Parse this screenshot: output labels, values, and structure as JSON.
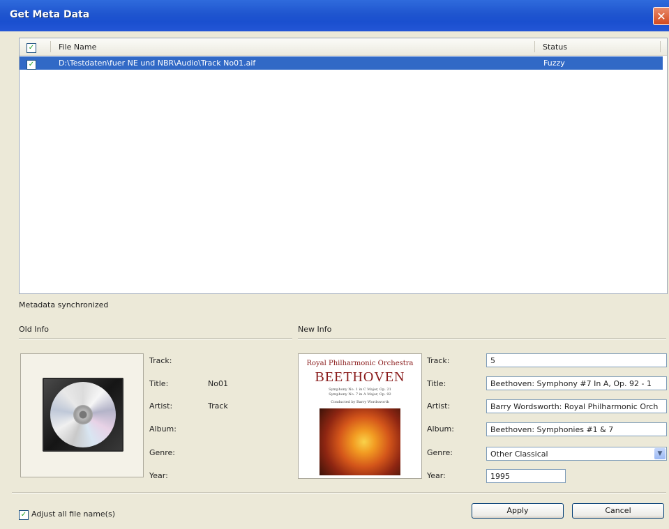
{
  "window": {
    "title": "Get Meta Data",
    "close_glyph": "✕"
  },
  "list": {
    "columns": {
      "name": "File Name",
      "status": "Status"
    },
    "rows": [
      {
        "checked": true,
        "file": "D:\\Testdaten\\fuer NE und NBR\\Audio\\Track No01.aif",
        "status": "Fuzzy"
      }
    ]
  },
  "status_message": "Metadata synchronized",
  "old_info": {
    "heading": "Old Info",
    "labels": {
      "track": "Track:",
      "title": "Title:",
      "artist": "Artist:",
      "album": "Album:",
      "genre": "Genre:",
      "year": "Year:"
    },
    "values": {
      "track": "",
      "title": "No01",
      "artist": "Track",
      "album": "",
      "genre": "",
      "year": ""
    },
    "art_icon": "cd-icon"
  },
  "new_info": {
    "heading": "New Info",
    "labels": {
      "track": "Track:",
      "title": "Title:",
      "artist": "Artist:",
      "album": "Album:",
      "genre": "Genre:",
      "year": "Year:"
    },
    "values": {
      "track": "5",
      "title": "Beethoven: Symphony #7 In A, Op. 92 - 1",
      "artist": "Barry Wordsworth: Royal Philharmonic Orch",
      "album": "Beethoven: Symphonies #1 & 7",
      "genre": "Other Classical",
      "year": "1995"
    },
    "cover": {
      "orchestra": "Royal Philharmonic Orchestra",
      "composer": "BEETHOVEN",
      "line1": "Symphony No. 1 in C Major, Op. 21",
      "line2": "Symphony No. 7 in A Major, Op. 92",
      "line3": "Conducted by Barry Wordsworth"
    }
  },
  "footer": {
    "adjust_label": "Adjust all file name(s)",
    "adjust_checked": true,
    "apply": "Apply",
    "cancel": "Cancel"
  },
  "glyphs": {
    "check": "✓",
    "dropdown": "▼"
  }
}
